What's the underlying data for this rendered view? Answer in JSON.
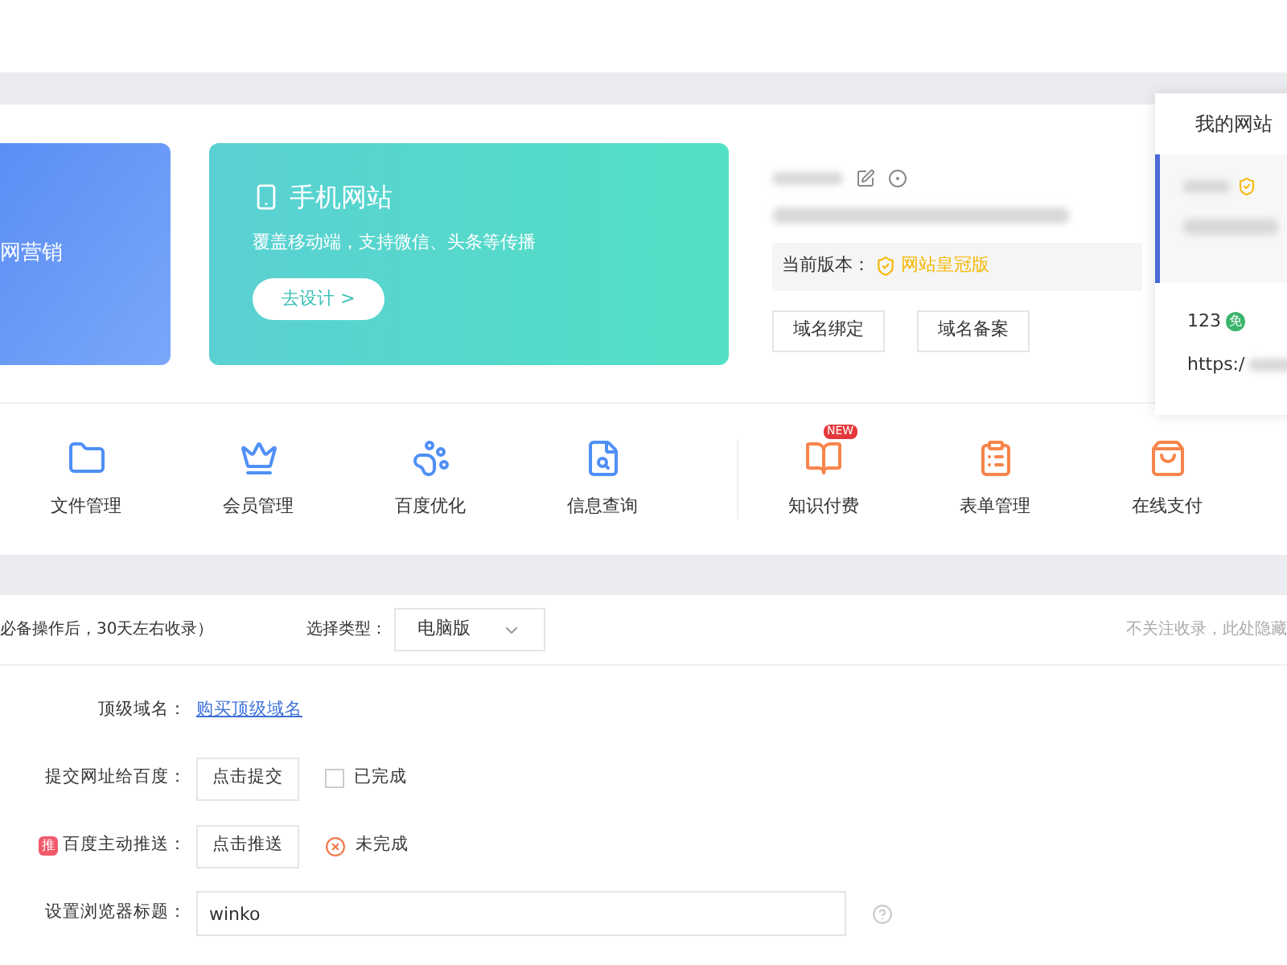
{
  "banners": [
    {
      "kind": "pc",
      "title": "网营销"
    },
    {
      "kind": "mobile",
      "title": "手机网站",
      "subtitle": "覆盖移动端，支持微信、头条等传播",
      "button": "去设计 >"
    }
  ],
  "site_info": {
    "version_label": "当前版本：",
    "version": "网站皇冠版",
    "buttons": [
      "域名绑定",
      "域名备案"
    ]
  },
  "features": [
    {
      "label": "文件管理",
      "color": "#4f8ff7"
    },
    {
      "label": "会员管理",
      "color": "#4f8ff7"
    },
    {
      "label": "百度优化",
      "color": "#4f8ff7"
    },
    {
      "label": "信息查询",
      "color": "#4f8ff7"
    },
    {
      "label": "知识付费",
      "color": "#f7844a",
      "badge": "NEW"
    },
    {
      "label": "表单管理",
      "color": "#f7844a"
    },
    {
      "label": "在线支付",
      "color": "#f7844a"
    }
  ],
  "popover": {
    "title": "我的网站",
    "count": "123",
    "badge": "免",
    "url": "https:/"
  },
  "seo": {
    "note": "必备操作后，30天左右收录）",
    "type_label": "选择类型：",
    "type_value": "电脑版",
    "hide_link": "不关注收录，此处隐藏",
    "rows": [
      {
        "kind": "link",
        "label": "顶级域名：",
        "link": "购买顶级域名"
      },
      {
        "kind": "check",
        "label": "提交网址给百度：",
        "button": "点击提交",
        "status": "已完成",
        "checked": false
      },
      {
        "kind": "status",
        "label": "百度主动推送：",
        "tag": "推",
        "button": "点击推送",
        "status": "未完成",
        "done": false
      },
      {
        "kind": "input",
        "label": "设置浏览器标题：",
        "value": "winko"
      }
    ]
  }
}
